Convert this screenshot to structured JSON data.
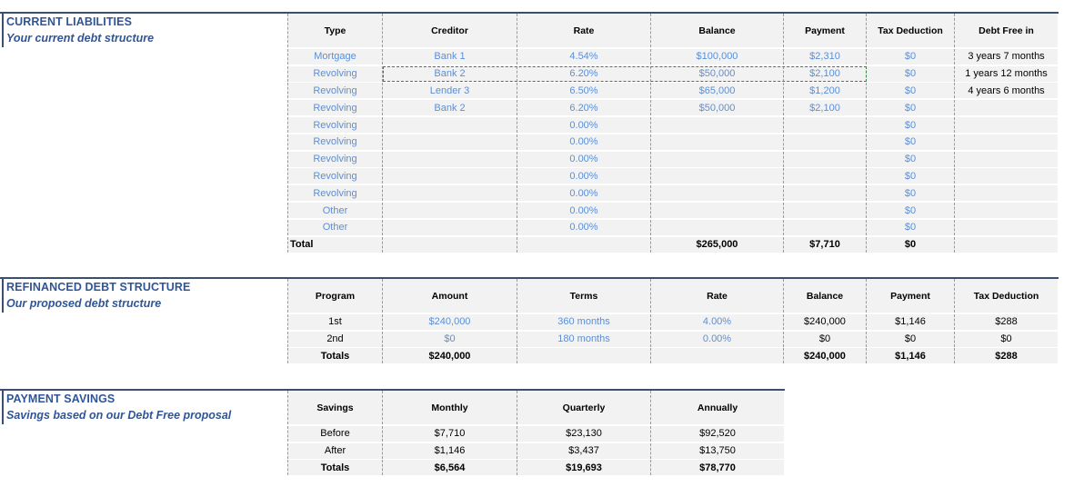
{
  "current_liabilities": {
    "title": "CURRENT LIABILITIES",
    "subtitle": "Your current debt structure",
    "headers": [
      "Type",
      "Creditor",
      "Rate",
      "Balance",
      "Payment",
      "Tax Deduction",
      "Debt Free in"
    ],
    "rows": [
      {
        "type": "Mortgage",
        "creditor": "Bank 1",
        "rate": "4.54%",
        "balance": "$100,000",
        "payment": "$2,310",
        "tax": "$0",
        "debt_free": "3 years 7 months"
      },
      {
        "type": "Revolving",
        "creditor": "Bank 2",
        "rate": "6.20%",
        "balance": "$50,000",
        "payment": "$2,100",
        "tax": "$0",
        "debt_free": "1 years 12 months"
      },
      {
        "type": "Revolving",
        "creditor": "Lender 3",
        "rate": "6.50%",
        "balance": "$65,000",
        "payment": "$1,200",
        "tax": "$0",
        "debt_free": "4 years 6 months"
      },
      {
        "type": "Revolving",
        "creditor": "Bank 2",
        "rate": "6.20%",
        "balance": "$50,000",
        "payment": "$2,100",
        "tax": "$0",
        "debt_free": ""
      },
      {
        "type": "Revolving",
        "creditor": "",
        "rate": "0.00%",
        "balance": "",
        "payment": "",
        "tax": "$0",
        "debt_free": ""
      },
      {
        "type": "Revolving",
        "creditor": "",
        "rate": "0.00%",
        "balance": "",
        "payment": "",
        "tax": "$0",
        "debt_free": ""
      },
      {
        "type": "Revolving",
        "creditor": "",
        "rate": "0.00%",
        "balance": "",
        "payment": "",
        "tax": "$0",
        "debt_free": ""
      },
      {
        "type": "Revolving",
        "creditor": "",
        "rate": "0.00%",
        "balance": "",
        "payment": "",
        "tax": "$0",
        "debt_free": ""
      },
      {
        "type": "Revolving",
        "creditor": "",
        "rate": "0.00%",
        "balance": "",
        "payment": "",
        "tax": "$0",
        "debt_free": ""
      },
      {
        "type": "Other",
        "creditor": "",
        "rate": "0.00%",
        "balance": "",
        "payment": "",
        "tax": "$0",
        "debt_free": ""
      },
      {
        "type": "Other",
        "creditor": "",
        "rate": "0.00%",
        "balance": "",
        "payment": "",
        "tax": "$0",
        "debt_free": ""
      }
    ],
    "total": {
      "label": "Total",
      "balance": "$265,000",
      "payment": "$7,710",
      "tax": "$0"
    }
  },
  "refinanced": {
    "title": "REFINANCED DEBT STRUCTURE",
    "subtitle": "Our proposed debt structure",
    "headers": [
      "Program",
      "Amount",
      "Terms",
      "Rate",
      "Balance",
      "Payment",
      "Tax Deduction"
    ],
    "rows": [
      {
        "program": "1st",
        "amount": "$240,000",
        "terms": "360 months",
        "rate": "4.00%",
        "balance": "$240,000",
        "payment": "$1,146",
        "tax": "$288"
      },
      {
        "program": "2nd",
        "amount": "$0",
        "terms": "180 months",
        "rate": "0.00%",
        "balance": "$0",
        "payment": "$0",
        "tax": "$0"
      }
    ],
    "totals": {
      "label": "Totals",
      "amount": "$240,000",
      "balance": "$240,000",
      "payment": "$1,146",
      "tax": "$288"
    }
  },
  "payment_savings": {
    "title": "PAYMENT SAVINGS",
    "subtitle": "Savings based on our Debt Free proposal",
    "headers": [
      "Savings",
      "Monthly",
      "Quarterly",
      "Annually"
    ],
    "rows": [
      {
        "label": "Before",
        "monthly": "$7,710",
        "quarterly": "$23,130",
        "annually": "$92,520"
      },
      {
        "label": "After",
        "monthly": "$1,146",
        "quarterly": "$3,437",
        "annually": "$13,750"
      }
    ],
    "totals": {
      "label": "Totals",
      "monthly": "$6,564",
      "quarterly": "$19,693",
      "annually": "$78,770"
    }
  },
  "colors": {
    "accent": "#3a5070",
    "title": "#2f5597",
    "input_text": "#5b8fd6",
    "cell_bg": "#f2f2f2",
    "selection": "#2e8b3e"
  }
}
